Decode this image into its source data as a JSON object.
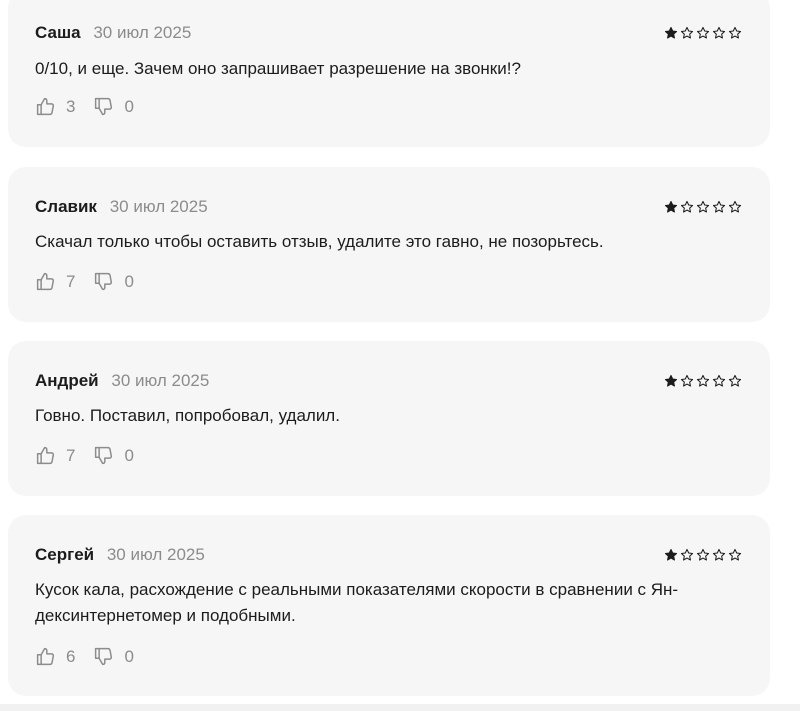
{
  "reviews": [
    {
      "author": "Саша",
      "date": "30 июл 2025",
      "rating": 1,
      "max_rating": 5,
      "text": "0/10, и еще. Зачем оно запрашивает разрешение на звонки!?",
      "likes": "3",
      "dislikes": "0"
    },
    {
      "author": "Славик",
      "date": "30 июл 2025",
      "rating": 1,
      "max_rating": 5,
      "text": "Скачал только чтобы оставить отзыв, удалите это гавно, не позорьтесь.",
      "likes": "7",
      "dislikes": "0"
    },
    {
      "author": "Андрей",
      "date": "30 июл 2025",
      "rating": 1,
      "max_rating": 5,
      "text": "Говно. Поставил, попробовал, удалил.",
      "likes": "7",
      "dislikes": "0"
    },
    {
      "author": "Сергей",
      "date": "30 июл 2025",
      "rating": 1,
      "max_rating": 5,
      "text": "Кусок кала, расхождение с реальными показателями скорости в сравнении с Ян-дексинтернетомер и подобными.",
      "likes": "6",
      "dislikes": "0"
    }
  ],
  "icons": {
    "like": "thumbs-up-icon",
    "dislike": "thumbs-down-icon",
    "star_filled": "star-filled-icon",
    "star_empty": "star-outline-icon"
  },
  "colors": {
    "card_background": "#f6f6f6",
    "text": "#1c1c1c",
    "muted": "#8c8c8c"
  }
}
